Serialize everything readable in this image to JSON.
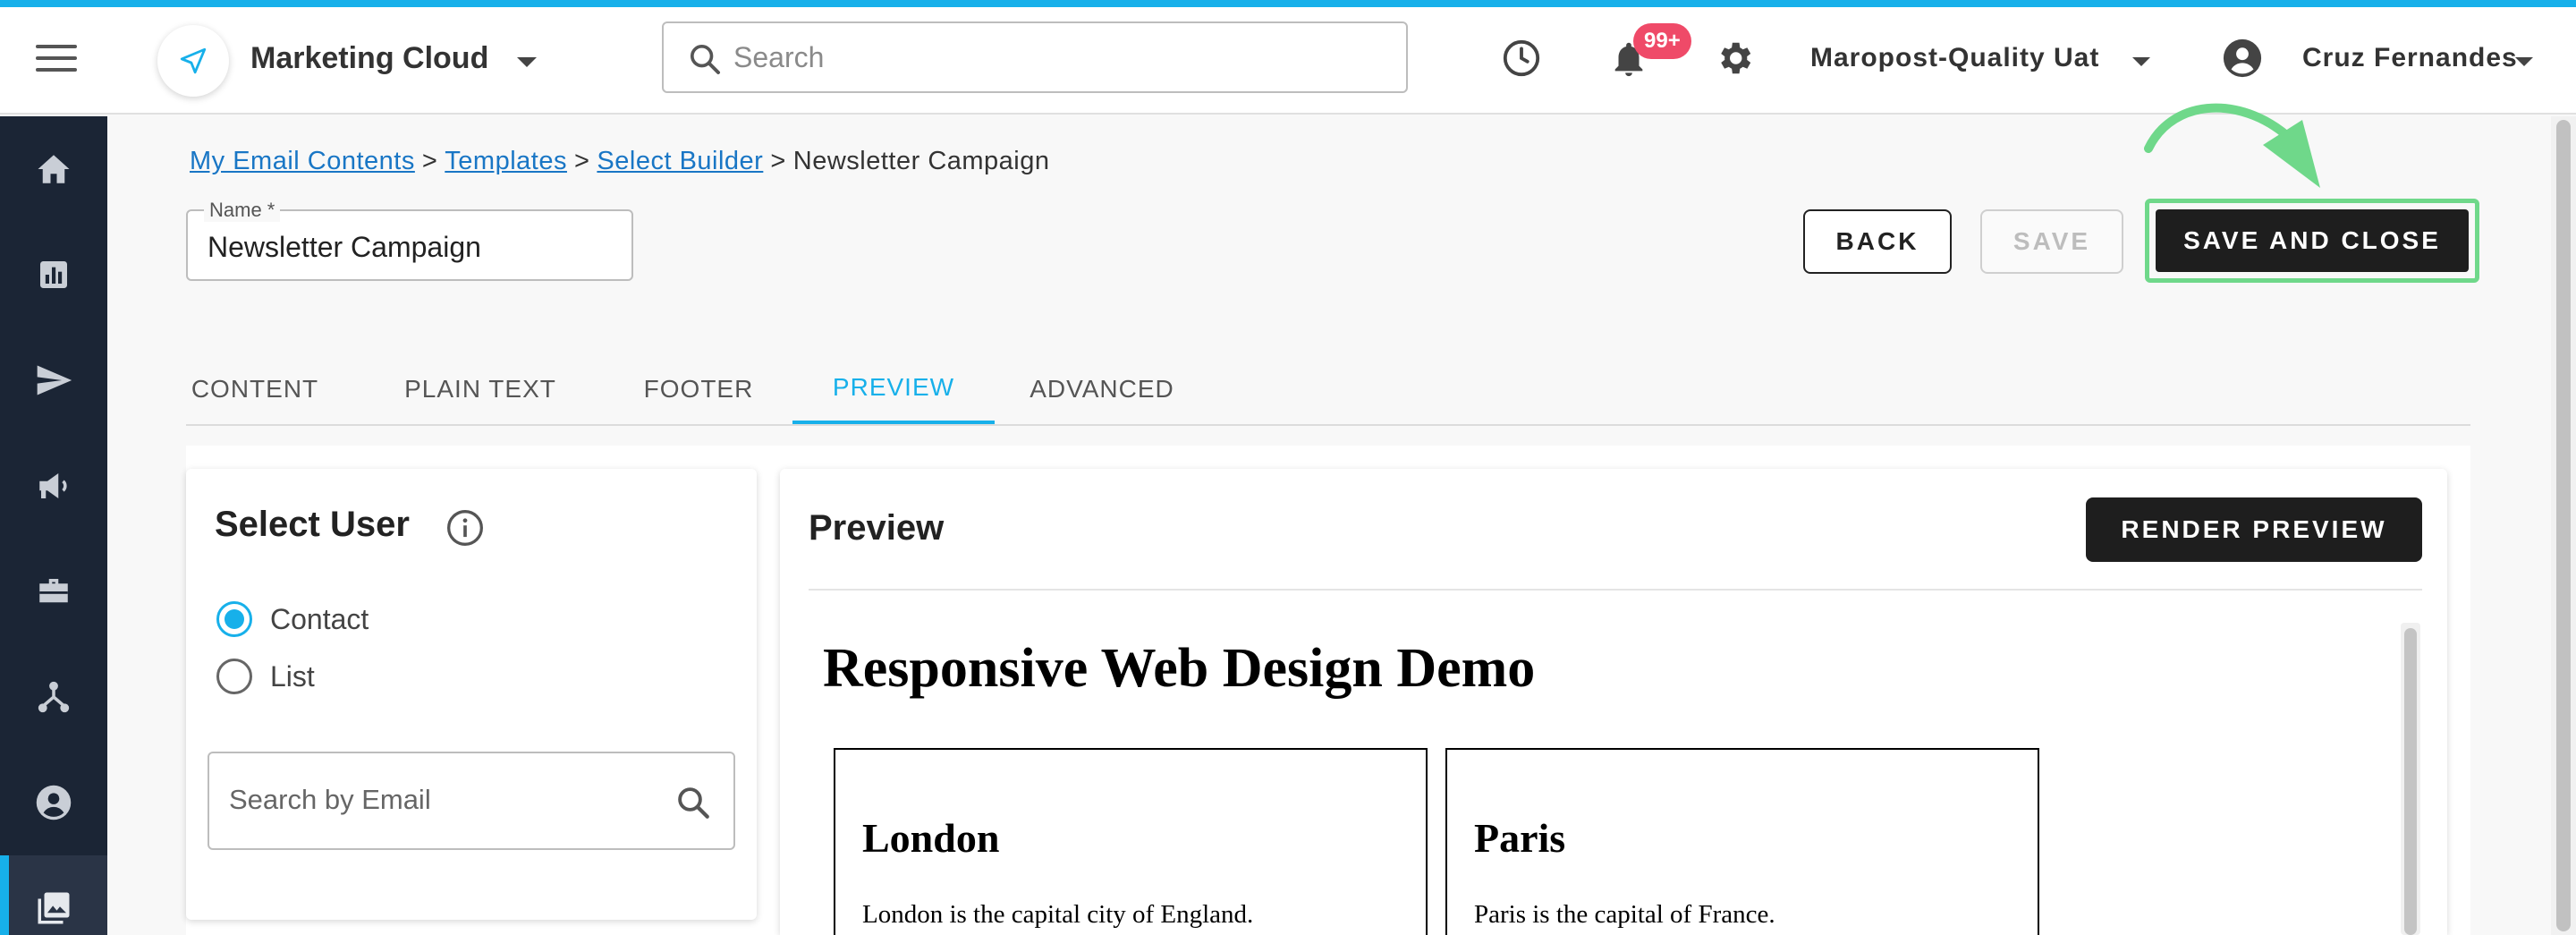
{
  "header": {
    "app_name": "Marketing Cloud",
    "search_placeholder": "Search",
    "notification_count": "99+",
    "org_name": "Maropost-Quality Uat",
    "user_name": "Cruz Fernandes"
  },
  "sidebar": {
    "items": [
      {
        "icon": "home-icon"
      },
      {
        "icon": "analytics-icon"
      },
      {
        "icon": "send-icon"
      },
      {
        "icon": "megaphone-icon"
      },
      {
        "icon": "briefcase-icon"
      },
      {
        "icon": "journey-icon"
      },
      {
        "icon": "contacts-icon"
      },
      {
        "icon": "content-icon",
        "active": true
      }
    ]
  },
  "breadcrumb": {
    "items": [
      "My Email Contents",
      "Templates",
      "Select Builder"
    ],
    "current": "Newsletter Campaign",
    "separator": ">"
  },
  "name_field": {
    "label": "Name *",
    "value": "Newsletter Campaign"
  },
  "actions": {
    "back": "BACK",
    "save": "SAVE",
    "save_and_close": "SAVE AND CLOSE"
  },
  "tabs": [
    {
      "label": "CONTENT"
    },
    {
      "label": "PLAIN TEXT"
    },
    {
      "label": "FOOTER"
    },
    {
      "label": "PREVIEW",
      "active": true
    },
    {
      "label": "ADVANCED"
    }
  ],
  "select_user": {
    "title": "Select User",
    "options": [
      {
        "label": "Contact",
        "checked": true
      },
      {
        "label": "List",
        "checked": false
      }
    ],
    "search_placeholder": "Search by Email"
  },
  "preview": {
    "title": "Preview",
    "render_button": "RENDER PREVIEW",
    "document": {
      "heading": "Responsive Web Design Demo",
      "cities": [
        {
          "name": "London",
          "text": "London is the capital city of England."
        },
        {
          "name": "Paris",
          "text": "Paris is the capital of France."
        }
      ]
    }
  },
  "colors": {
    "accent": "#17b0ea",
    "sidebar": "#1b2535",
    "highlight": "#6fd88a",
    "badge": "#ef4a68"
  }
}
